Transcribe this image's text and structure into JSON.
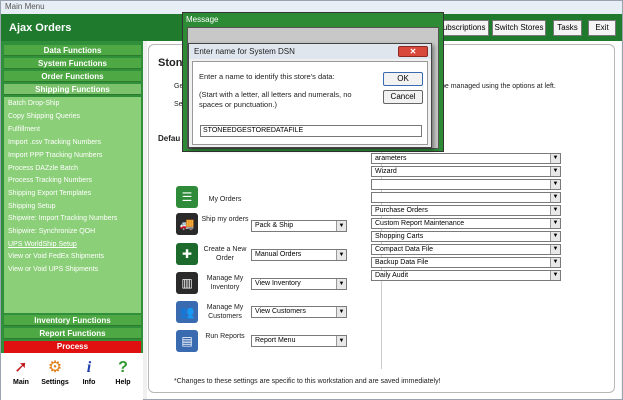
{
  "titlebar": {
    "title": "Main Menu"
  },
  "header": {
    "app_title": "Ajax Orders",
    "buttons": {
      "subscriptions": "Subscriptions",
      "switch_stores": "Switch Stores",
      "tasks": "Tasks",
      "exit": "Exit"
    }
  },
  "sidebar": {
    "sections_top": [
      "Data Functions",
      "System Functions",
      "Order Functions",
      "Shipping Functions"
    ],
    "items": [
      "Batch Drop-Ship",
      "Copy Shipping Queries",
      "Fulfillment",
      "Import .csv Tracking Numbers",
      "Import PPP Tracking Numbers",
      "Process DAZzle Batch",
      "Process Tracking Numbers",
      "Shipping Export Templates",
      "Shipping Setup",
      "Shipwire: Import Tracking Numbers",
      "Shipwire: Synchronize QOH",
      "UPS WorldShip Setup",
      "View or Void FedEx Shipments",
      "View or Void UPS Shipments"
    ],
    "sections_bottom": [
      "Inventory Functions",
      "Report Functions"
    ],
    "process_label": "Process",
    "tools": [
      {
        "label": "Main",
        "icon": "cursor-icon"
      },
      {
        "label": "Settings",
        "icon": "gear-icon"
      },
      {
        "label": "Info",
        "icon": "info-icon"
      },
      {
        "label": "Help",
        "icon": "help-icon"
      }
    ]
  },
  "main": {
    "title": "Stone",
    "desc_left_1": "Ge",
    "desc_left_2": "Se",
    "desc_right": "be managed using the options at left.",
    "defaults_label": "Defau",
    "actions": [
      {
        "label": "My Orders",
        "select": ""
      },
      {
        "label": "Ship my orders",
        "select": "Pack & Ship"
      },
      {
        "label": "Create a New Order",
        "select": "Manual Orders"
      },
      {
        "label": "Manage My Inventory",
        "select": "View Inventory"
      },
      {
        "label": "Manage My Customers",
        "select": "View Customers"
      },
      {
        "label": "Run Reports",
        "select": "Report Menu"
      }
    ],
    "right_selects": [
      "arameters",
      "Wizard",
      "",
      "",
      "Purchase Orders",
      "Custom Report Maintenance",
      "Shopping Carts",
      "Compact Data File",
      "Backup Data File",
      "Daily Audit"
    ],
    "footnote": "*Changes to these settings are specific to this workstation and are saved immediately!"
  },
  "message_dialog": {
    "title": "Message"
  },
  "input_dialog": {
    "title": "Enter name for System DSN",
    "close_label": "✕",
    "prompt": "Enter a name to identify this store's data:",
    "hint": "(Start with a letter, all letters and numerals, no spaces or punctuation.)",
    "ok_label": "OK",
    "cancel_label": "Cancel",
    "value": "STONEEDGESTOREDATAFILE"
  },
  "colors": {
    "header_green": "#1f7a2e",
    "sidebar_green": "#2f8f3a",
    "process_red": "#e01010"
  }
}
